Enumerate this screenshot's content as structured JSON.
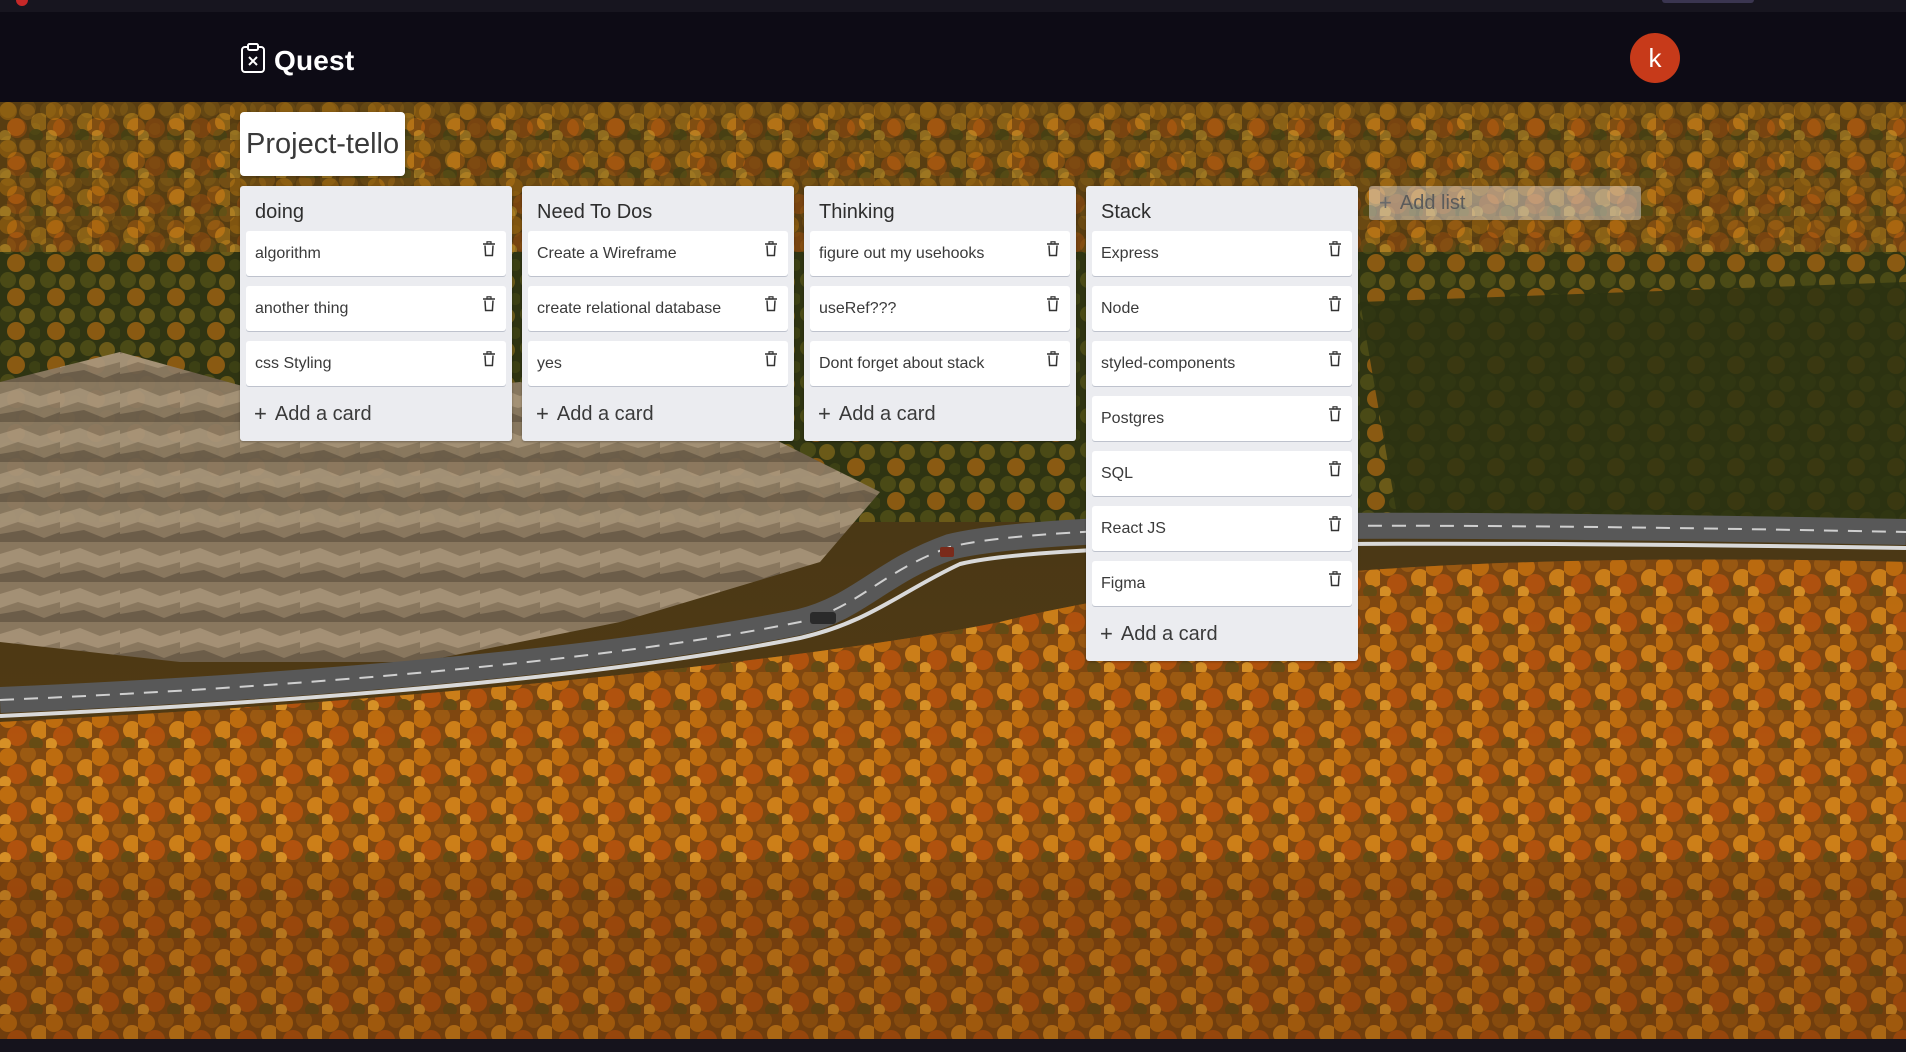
{
  "app": {
    "title": "Quest",
    "logo_icon": "clipboard-x-icon",
    "avatar_initial": "k",
    "avatar_color": "#c73a1a"
  },
  "board": {
    "title": "Project-tello",
    "background": "autumn-mountain-road-photo",
    "add_list_label": "Add list",
    "add_card_label": "Add a card",
    "card_icon": "trash-icon",
    "lists": [
      {
        "title": "doing",
        "cards": [
          "algorithm",
          "another thing",
          "css Styling"
        ]
      },
      {
        "title": "Need To Dos",
        "cards": [
          "Create a Wireframe",
          "create relational database",
          "yes"
        ]
      },
      {
        "title": "Thinking",
        "cards": [
          "figure out my usehooks",
          "useRef???",
          "Dont forget about stack"
        ]
      },
      {
        "title": "Stack",
        "cards": [
          "Express",
          "Node",
          "styled-components",
          "Postgres",
          "SQL",
          "React JS",
          "Figma"
        ]
      }
    ]
  }
}
